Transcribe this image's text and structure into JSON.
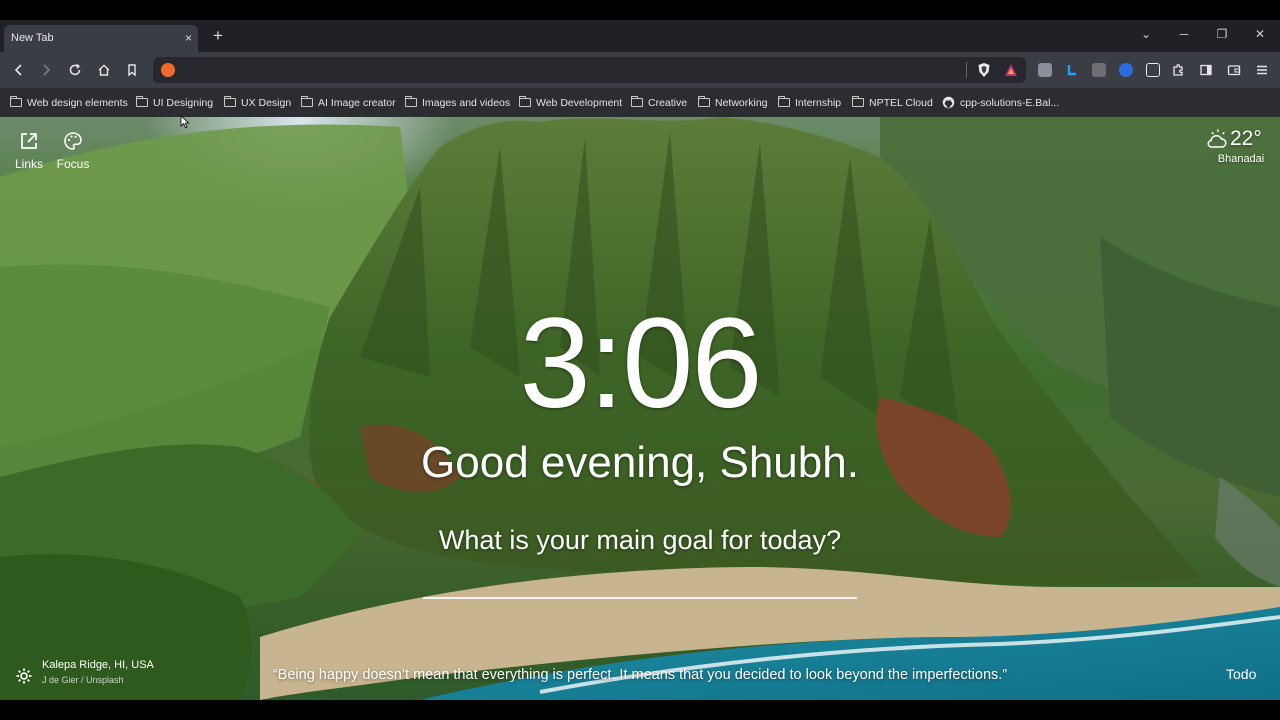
{
  "tab": {
    "title": "New Tab",
    "close": "×",
    "new": "+"
  },
  "window_controls": {
    "list": "⌄",
    "minimize": "─",
    "restore": "❐",
    "close": "✕"
  },
  "omnibox": {
    "value": "",
    "placeholder": ""
  },
  "bookmarks": [
    {
      "label": "Web design elements",
      "icon": "folder-icon"
    },
    {
      "label": "UI Designing",
      "icon": "folder-icon"
    },
    {
      "label": "UX Design",
      "icon": "folder-icon"
    },
    {
      "label": "AI Image creator",
      "icon": "folder-icon"
    },
    {
      "label": "Images and videos",
      "icon": "folder-icon"
    },
    {
      "label": "Web Development",
      "icon": "folder-icon"
    },
    {
      "label": "Creative",
      "icon": "folder-icon"
    },
    {
      "label": "Networking",
      "icon": "folder-icon"
    },
    {
      "label": "Internship",
      "icon": "folder-icon"
    },
    {
      "label": "NPTEL Cloud",
      "icon": "folder-icon"
    },
    {
      "label": "cpp-solutions-E.Bal...",
      "icon": "github-icon"
    }
  ],
  "widgets": {
    "links": "Links",
    "focus": "Focus",
    "weather": {
      "temp": "22°",
      "location": "Bhanadai"
    }
  },
  "main": {
    "time": "3:06",
    "greeting": "Good evening, Shubh.",
    "question": "What is your main goal for today?",
    "quote": "“Being happy doesn’t mean that everything is perfect. It means that you decided to look beyond the imperfections.”"
  },
  "footer": {
    "photo_title": "Kalepa Ridge, HI, USA",
    "photo_author": "J de Gier / Unsplash",
    "todo": "Todo"
  },
  "colors": {
    "accent_tab": "#3a3d44",
    "toolbar": "#3a3d44",
    "bookmarks_bar": "#2b2d31"
  }
}
